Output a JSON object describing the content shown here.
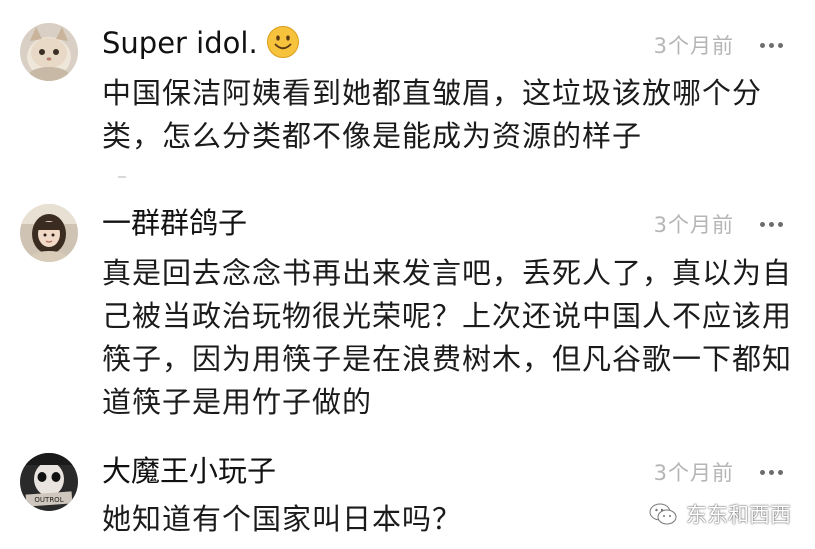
{
  "comments": [
    {
      "username": "Super idol.",
      "emoji": "smiley-emoji",
      "time": "3个月前",
      "text": "中国保洁阿姨看到她都直皱眉，这垃圾该放哪个分类，怎么分类都不像是能成为资源的样子"
    },
    {
      "username": "一群群鸽子",
      "time": "3个月前",
      "text": "真是回去念念书再出来发言吧，丢死人了，真以为自己被当政治玩物很光荣呢？上次还说中国人不应该用筷子，因为用筷子是在浪费树木，但凡谷歌一下都知道筷子是用竹子做的"
    },
    {
      "username": "大魔王小玩子",
      "time": "3个月前",
      "text": "她知道有个国家叫日本吗？"
    }
  ],
  "watermark": {
    "icon": "wechat-icon",
    "text": "东东和西西"
  },
  "colors": {
    "text": "#1b1b1b",
    "time": "#b5b5b5",
    "more_dots": "#6d6d6d",
    "emoji_face": "#f7c23c"
  }
}
